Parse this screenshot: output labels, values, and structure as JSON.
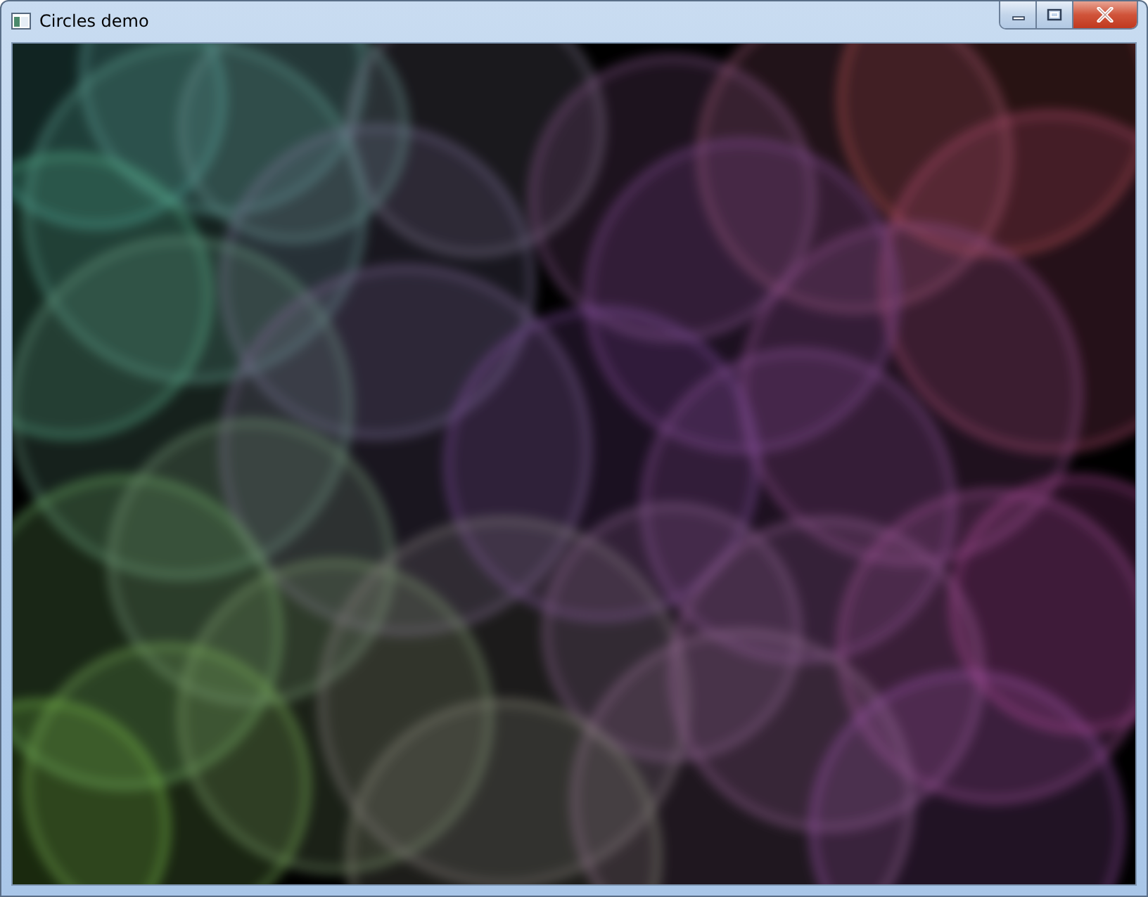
{
  "window": {
    "title": "Circles demo"
  }
}
